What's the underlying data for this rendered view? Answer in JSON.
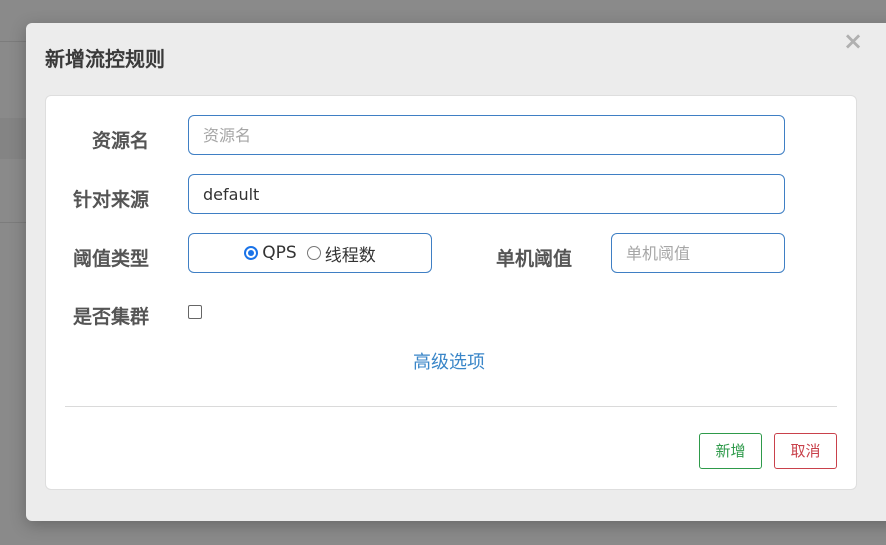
{
  "modal": {
    "title": "新增流控规则",
    "close_symbol": "×"
  },
  "form": {
    "resource_label": "资源名",
    "resource_placeholder": "资源名",
    "resource_value": "",
    "origin_label": "针对来源",
    "origin_value": "default",
    "threshold_type_label": "阈值类型",
    "threshold_type_options": [
      "QPS",
      "线程数"
    ],
    "threshold_type_selected": "QPS",
    "single_threshold_label": "单机阈值",
    "single_threshold_placeholder": "单机阈值",
    "cluster_label": "是否集群",
    "cluster_checked": false,
    "advanced_link": "高级选项"
  },
  "footer": {
    "add_label": "新增",
    "cancel_label": "取消"
  },
  "colors": {
    "accent": "#3f7fc4",
    "add_button": "#2e9a4a",
    "cancel_button": "#c9414b",
    "link": "#3a86c8"
  }
}
